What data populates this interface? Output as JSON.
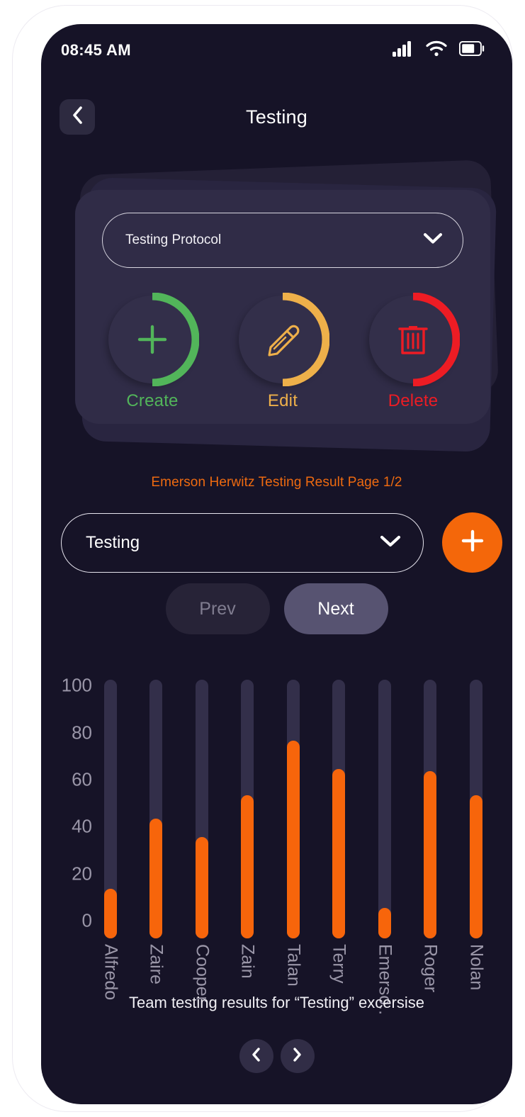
{
  "status_bar": {
    "time": "08:45 AM",
    "signal_icon": "cellular-signal-icon",
    "wifi_icon": "wifi-icon",
    "battery_icon": "battery-icon"
  },
  "app_bar": {
    "title": "Testing",
    "back_icon": "chevron-left-icon"
  },
  "protocol_card": {
    "select": {
      "value": "Testing Protocol",
      "chevron_icon": "chevron-down-icon"
    },
    "actions": [
      {
        "label": "Create",
        "icon": "plus-icon",
        "color": "#52b55a"
      },
      {
        "label": "Edit",
        "icon": "pencil-icon",
        "color": "#eeb04a"
      },
      {
        "label": "Delete",
        "icon": "trash-icon",
        "color": "#ed1c24"
      }
    ]
  },
  "results": {
    "header": "Emerson Herwitz Testing Result Page 1/2",
    "exercise_select": {
      "value": "Testing",
      "chevron_icon": "chevron-down-icon"
    },
    "add_button": {
      "icon": "plus-icon",
      "color": "#f4670a"
    },
    "pager": {
      "prev_label": "Prev",
      "prev_disabled": true,
      "next_label": "Next",
      "next_disabled": false
    }
  },
  "chart_data": {
    "type": "bar",
    "title": "Team testing results for “Testing” excersise",
    "xlabel": "",
    "ylabel": "",
    "ylim": [
      0,
      110
    ],
    "yticks": [
      100,
      80,
      60,
      40,
      20,
      0
    ],
    "grid": false,
    "legend": "none",
    "bar_color": "#f7650b",
    "track_color": "#332f4a",
    "track_max": 110,
    "categories": [
      "Alfredo",
      "Zaire",
      "Cooper",
      "Zain",
      "Talan",
      "Terry",
      "Emerso..",
      "Roger",
      "Nolan"
    ],
    "values": [
      21,
      51,
      43,
      61,
      84,
      72,
      13,
      71,
      61
    ]
  },
  "carousel_nav": {
    "prev_icon": "chevron-left-icon",
    "next_icon": "chevron-right-icon"
  }
}
